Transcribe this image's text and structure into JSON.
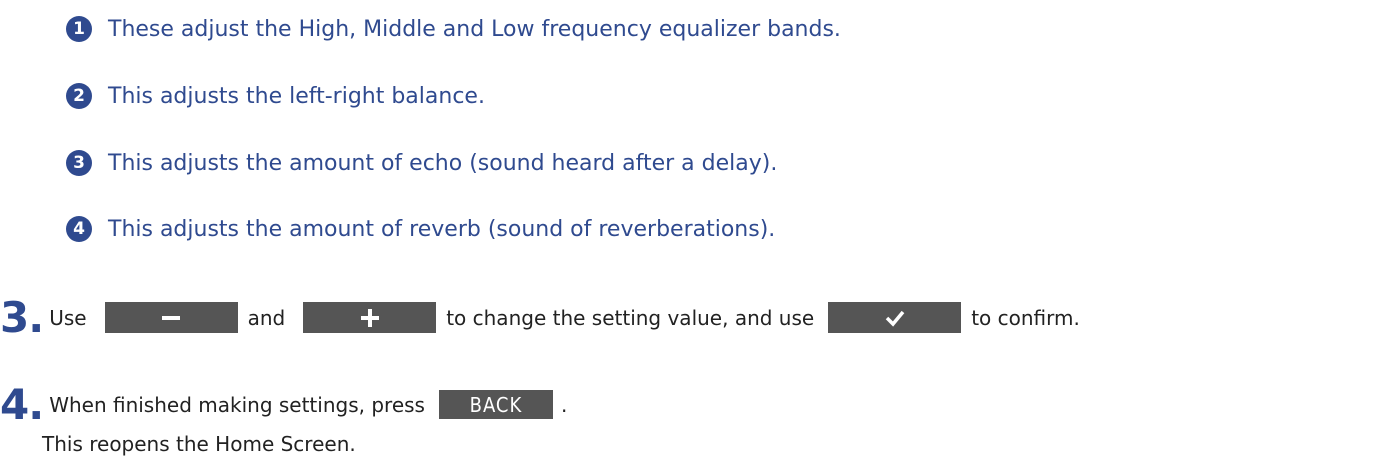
{
  "items": [
    {
      "badge": "1",
      "text": "These adjust the High, Middle and Low frequency equalizer bands."
    },
    {
      "badge": "2",
      "text": "This adjusts the left-right balance."
    },
    {
      "badge": "3",
      "text": "This adjusts the amount of echo (sound heard after a delay)."
    },
    {
      "badge": "4",
      "text": "This adjusts the amount of reverb (sound of reverberations)."
    }
  ],
  "step3": {
    "number": "3.",
    "use": "Use",
    "and": "and",
    "middle": "to change the setting value, and use",
    "end": "to confirm.",
    "minus_icon": "minus-icon",
    "plus_icon": "plus-icon",
    "check_icon": "checkmark-icon"
  },
  "step4": {
    "number": "4.",
    "text": "When finished making settings, press",
    "back_label": "BACK",
    "period": ".",
    "subtext": "This reopens the Home Screen."
  },
  "colors": {
    "accent": "#2f4a8f",
    "button": "#555555",
    "text": "#222222"
  }
}
